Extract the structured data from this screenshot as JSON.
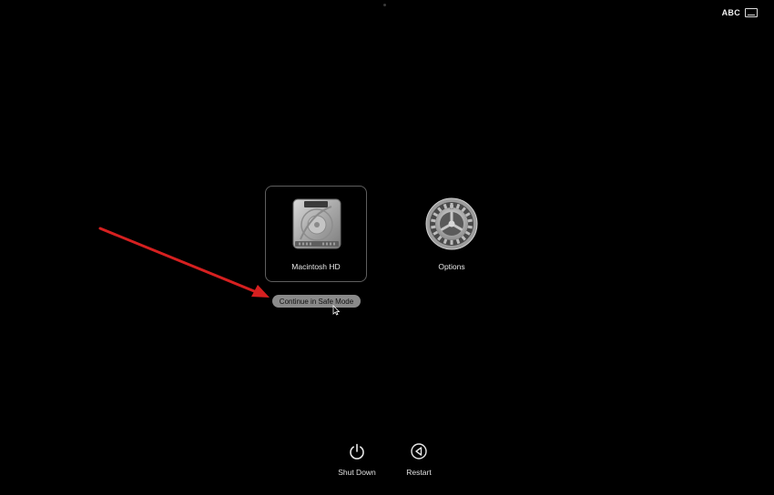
{
  "status_bar": {
    "input_source": "ABC",
    "input_icon": "keyboard-icon"
  },
  "startup_disks": [
    {
      "label": "Macintosh HD",
      "icon": "hard-drive-icon",
      "selected": true
    }
  ],
  "options": {
    "label": "Options",
    "icon": "gear-icon"
  },
  "safe_mode_button": {
    "label": "Continue in Safe Mode"
  },
  "annotation": {
    "arrow_color": "#d62020"
  },
  "bottom_bar": {
    "shutdown": {
      "label": "Shut Down",
      "icon": "power-icon"
    },
    "restart": {
      "label": "Restart",
      "icon": "restart-icon"
    }
  }
}
